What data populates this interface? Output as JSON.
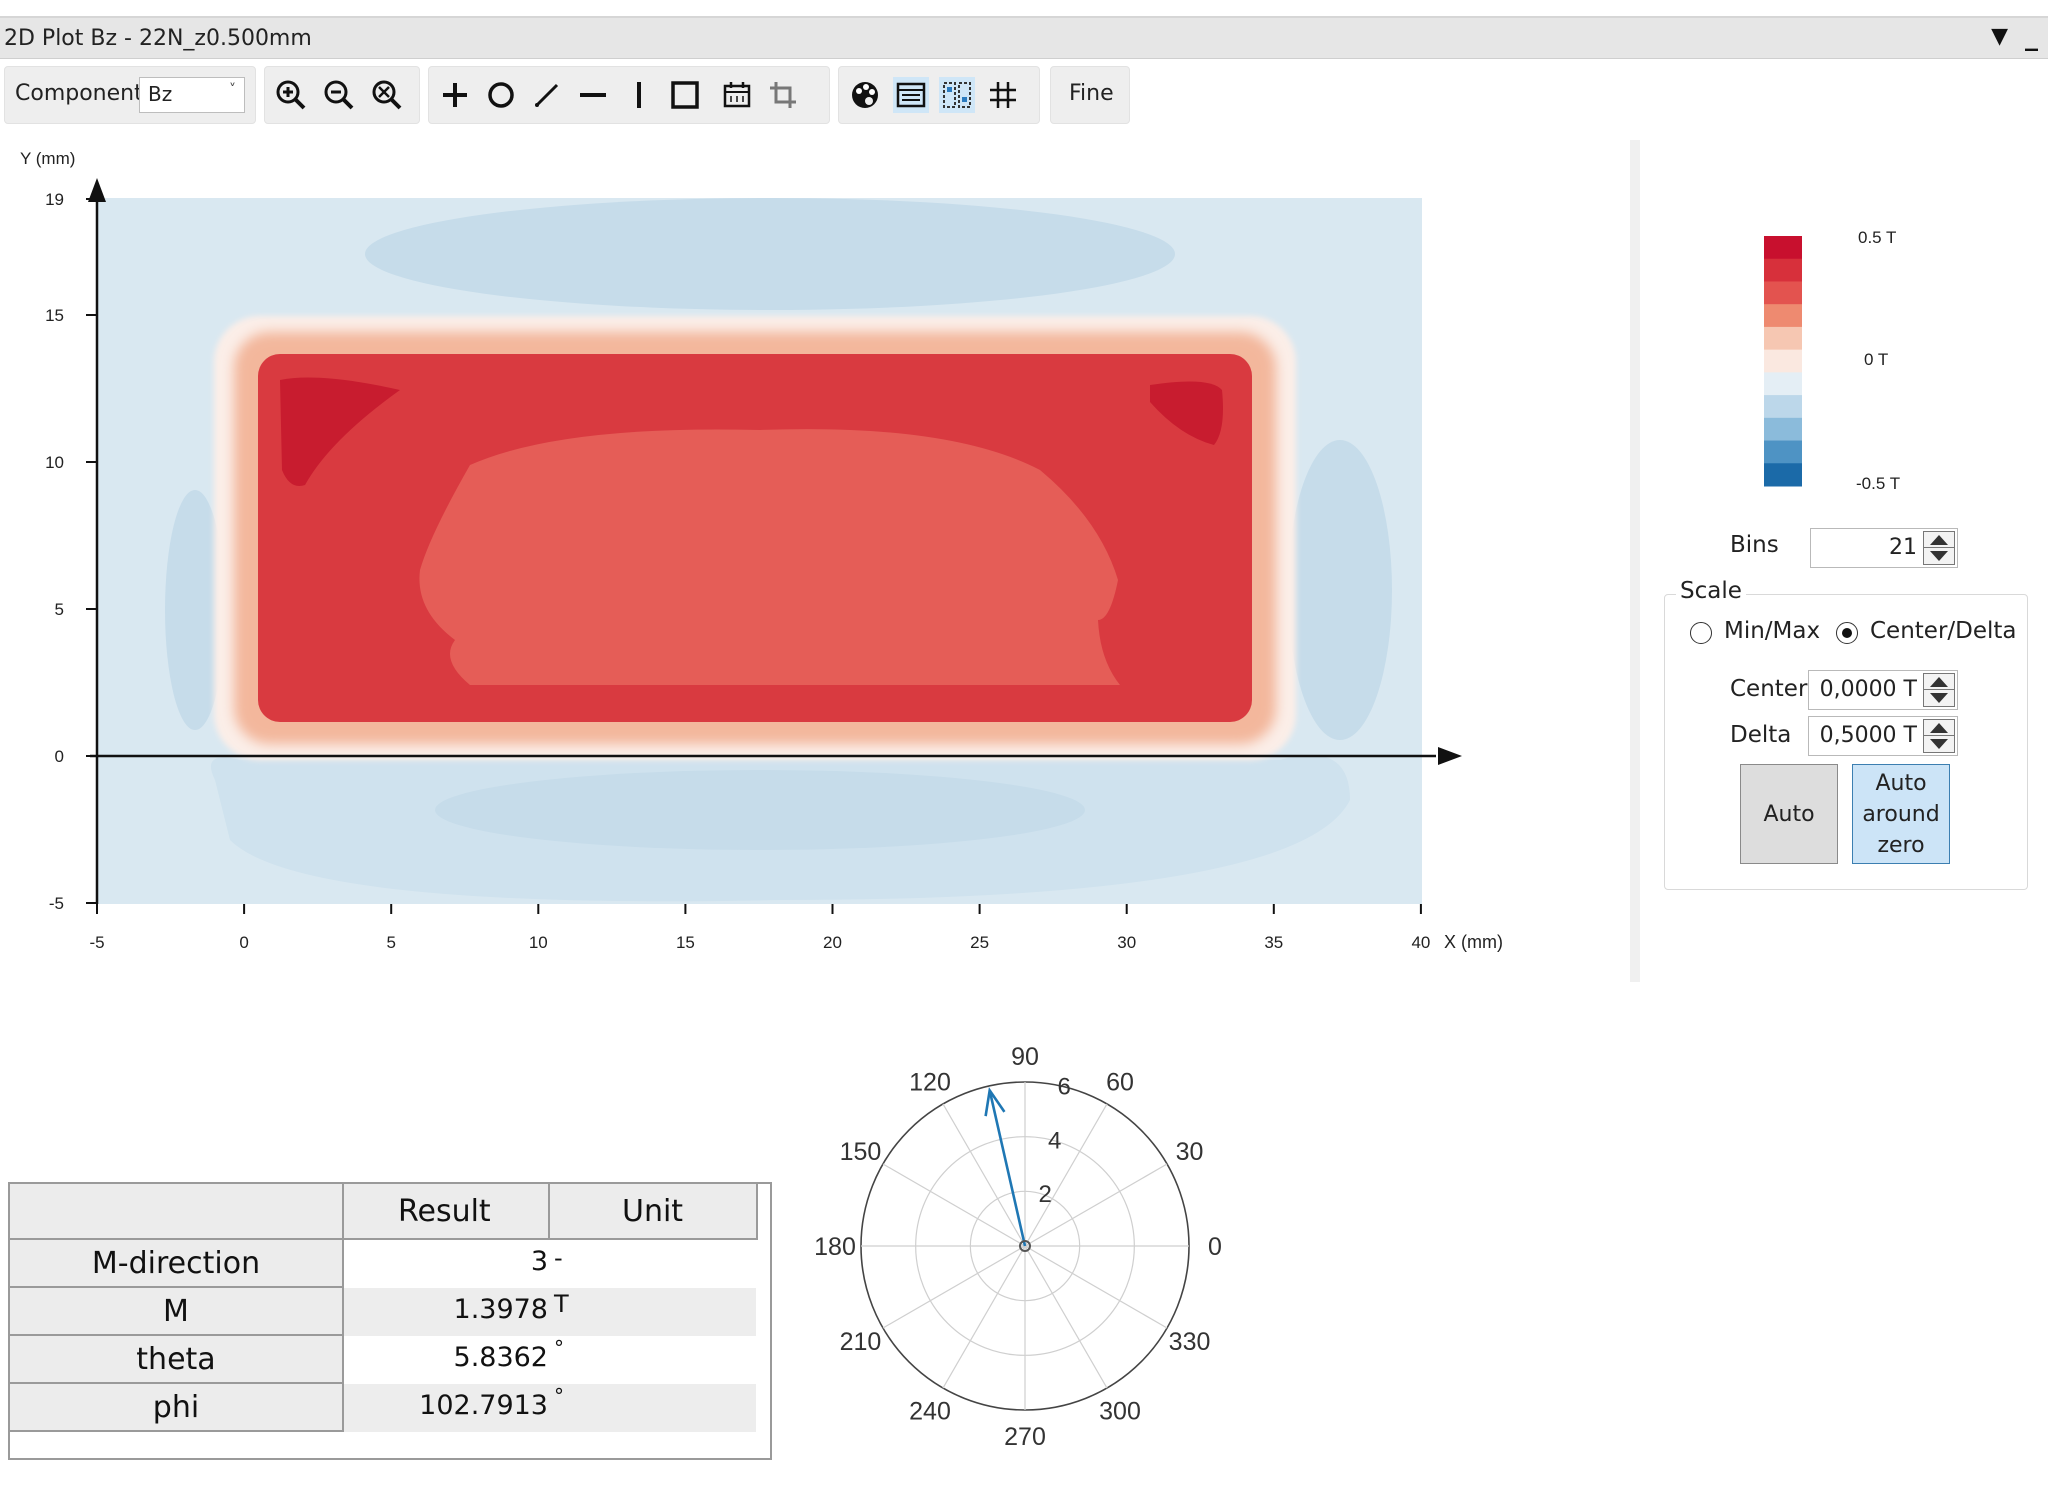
{
  "window": {
    "title": "2D Plot Bz - 22N_z0.500mm",
    "dropdown_glyph": "▼",
    "minimize_glyph": "_"
  },
  "toolbar": {
    "component_label": "Component",
    "component_value": "Bz",
    "component_caret": "˅",
    "fine_label": "Fine",
    "icons": [
      "zoom-in-icon",
      "zoom-out-icon",
      "zoom-fit-icon",
      "crosshair-icon",
      "circle-icon",
      "diagonal-line-icon",
      "horizontal-line-icon",
      "vertical-line-icon",
      "rectangle-icon",
      "calendar-grid-icon",
      "crop-icon",
      "palette-icon",
      "table-view-icon",
      "split-view-icon",
      "grid-icon"
    ]
  },
  "plot": {
    "y_axis_label": "Y (mm)",
    "x_axis_label": "X (mm)",
    "y_ticks": [
      "19",
      "15",
      "10",
      "5",
      "0",
      "-5"
    ],
    "x_ticks": [
      "-5",
      "0",
      "5",
      "10",
      "15",
      "20",
      "25",
      "30",
      "35",
      "40"
    ]
  },
  "colorbar": {
    "max_label": "0.5 T",
    "mid_label": "0 T",
    "min_label": "-0.5 T",
    "colors": [
      "#c8102e",
      "#d7303b",
      "#e3534f",
      "#ee8a70",
      "#f6c7b2",
      "#fae8e0",
      "#e4eef5",
      "#bcd7ea",
      "#8bbbdb",
      "#4e93c4",
      "#1b6aa8"
    ]
  },
  "settings": {
    "bins_label": "Bins",
    "bins_value": "21",
    "scale_label": "Scale",
    "minmax_label": "Min/Max",
    "minmax_selected": false,
    "centerdelta_label": "Center/Delta",
    "centerdelta_selected": true,
    "center_label": "Center",
    "center_value": "0,0000 T",
    "delta_label": "Delta",
    "delta_value": "0,5000 T",
    "auto_button": "Auto",
    "auto_zero_line1": "Auto",
    "auto_zero_line2": "around",
    "auto_zero_line3": "zero"
  },
  "results_table": {
    "headers": [
      "",
      "Result",
      "Unit"
    ],
    "rows": [
      {
        "name": "M-direction",
        "result": "3",
        "unit": "-"
      },
      {
        "name": "M",
        "result": "1.3978",
        "unit": "T"
      },
      {
        "name": "theta",
        "result": "5.8362",
        "unit": "°"
      },
      {
        "name": "phi",
        "result": "102.7913",
        "unit": "°"
      }
    ]
  },
  "polar": {
    "angle_labels": [
      "0",
      "30",
      "60",
      "90",
      "120",
      "150",
      "180",
      "210",
      "240",
      "270",
      "300",
      "330"
    ],
    "radial_labels": [
      "2",
      "4",
      "6"
    ],
    "r_max": 6,
    "vector_angle_deg": 102.7913,
    "vector_magnitude": 5.8362,
    "vector_color": "#1f77b4"
  }
}
